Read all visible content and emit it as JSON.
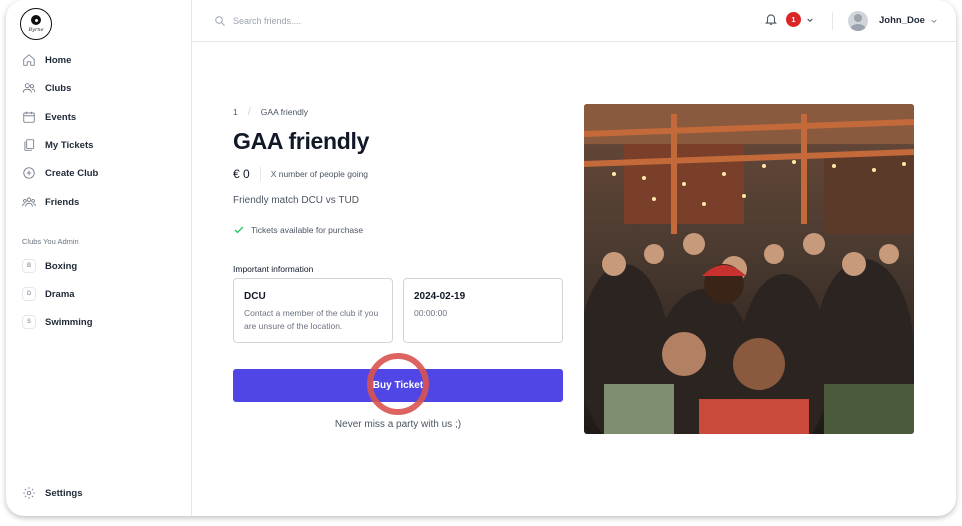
{
  "app": {
    "logo_text": "Byrne"
  },
  "sidebar": {
    "nav": [
      {
        "label": "Home",
        "icon": "home-icon"
      },
      {
        "label": "Clubs",
        "icon": "users-icon"
      },
      {
        "label": "Events",
        "icon": "calendar-icon"
      },
      {
        "label": "My Tickets",
        "icon": "documents-icon"
      },
      {
        "label": "Create Club",
        "icon": "plus-circle-icon"
      },
      {
        "label": "Friends",
        "icon": "user-group-icon"
      }
    ],
    "clubs_section_title": "Clubs You Admin",
    "clubs": [
      {
        "badge": "B",
        "label": "Boxing"
      },
      {
        "badge": "D",
        "label": "Drama"
      },
      {
        "badge": "S",
        "label": "Swimming"
      }
    ],
    "settings_label": "Settings"
  },
  "header": {
    "search_placeholder": "Search friends....",
    "notification_count": "1",
    "username": "John_Doe"
  },
  "event": {
    "breadcrumb": [
      "1",
      "GAA friendly"
    ],
    "title": "GAA friendly",
    "price": "€ 0",
    "going": "X number of people going",
    "description": "Friendly match DCU vs TUD",
    "availability": "Tickets available for purchase",
    "important_label": "Important information",
    "location_title": "DCU",
    "location_note": "Contact a member of the club if you are unsure of the location.",
    "date": "2024-02-19",
    "time": "00:00:00",
    "buy_label": "Buy Ticket",
    "tagline": "Never miss a party with us ;)"
  },
  "colors": {
    "accent": "#4f46e5",
    "badge": "#dc2626",
    "success": "#22c55e",
    "highlight_ring": "#d9534f"
  }
}
